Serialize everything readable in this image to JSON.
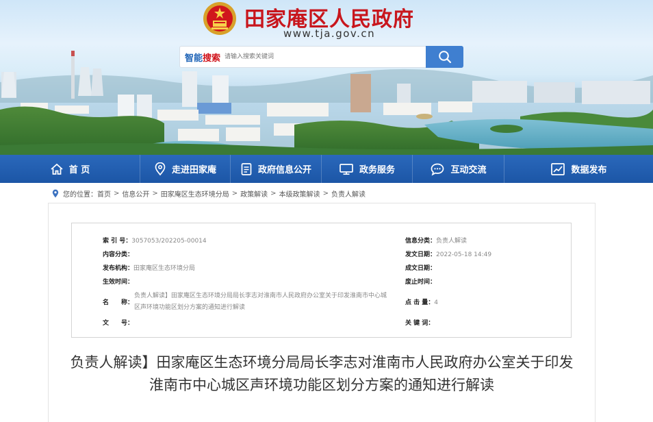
{
  "header": {
    "site_title": "田家庵区人民政府",
    "site_domain": "www.tja.gov.cn"
  },
  "search": {
    "brand_part1": "智能",
    "brand_part2": "搜索",
    "placeholder": "请输入搜索关键词"
  },
  "nav": {
    "items": [
      {
        "label": "首 页",
        "icon": "home-icon"
      },
      {
        "label": "走进田家庵",
        "icon": "map-pin-icon"
      },
      {
        "label": "政府信息公开",
        "icon": "document-icon"
      },
      {
        "label": "政务服务",
        "icon": "monitor-icon"
      },
      {
        "label": "互动交流",
        "icon": "chat-icon"
      },
      {
        "label": "数据发布",
        "icon": "chart-icon"
      }
    ]
  },
  "breadcrumb": {
    "prefix": "您的位置：",
    "items": [
      "首页",
      "信息公开",
      "田家庵区生态环境分局",
      "政策解读",
      "本级政策解读",
      "负责人解读"
    ]
  },
  "info": {
    "index_label": "索 引 号：",
    "index_value": "3057053/202205-00014",
    "category_label": "信息分类：",
    "category_value": "负责人解读",
    "content_category_label": "内容分类：",
    "content_category_value": "",
    "publish_date_label": "发文日期：",
    "publish_date_value": "2022-05-18 14:49",
    "publisher_label": "发布机构：",
    "publisher_value": "田家庵区生态环境分局",
    "created_date_label": "成文日期：",
    "created_date_value": "",
    "effective_label": "生效时间：",
    "effective_value": "",
    "expire_label": "废止时间：",
    "expire_value": "",
    "name_label": "名　　称：",
    "name_value": "负责人解读】田家庵区生态环境分局局长李志对淮南市人民政府办公室关于印发淮南市中心城区声环境功能区划分方案的通知进行解读",
    "clicks_label": "点 击 量：",
    "clicks_value": "4",
    "doc_number_label": "文　　号：",
    "doc_number_value": "",
    "keywords_label": "关 键 词：",
    "keywords_value": ""
  },
  "article": {
    "title": "负责人解读】田家庵区生态环境分局局长李志对淮南市人民政府办公室关于印发淮南市中心城区声环境功能区划分方案的通知进行解读"
  },
  "colors": {
    "title_red": "#c8161d",
    "nav_blue": "#1c56a6",
    "search_button_blue": "#3f7fd0"
  }
}
